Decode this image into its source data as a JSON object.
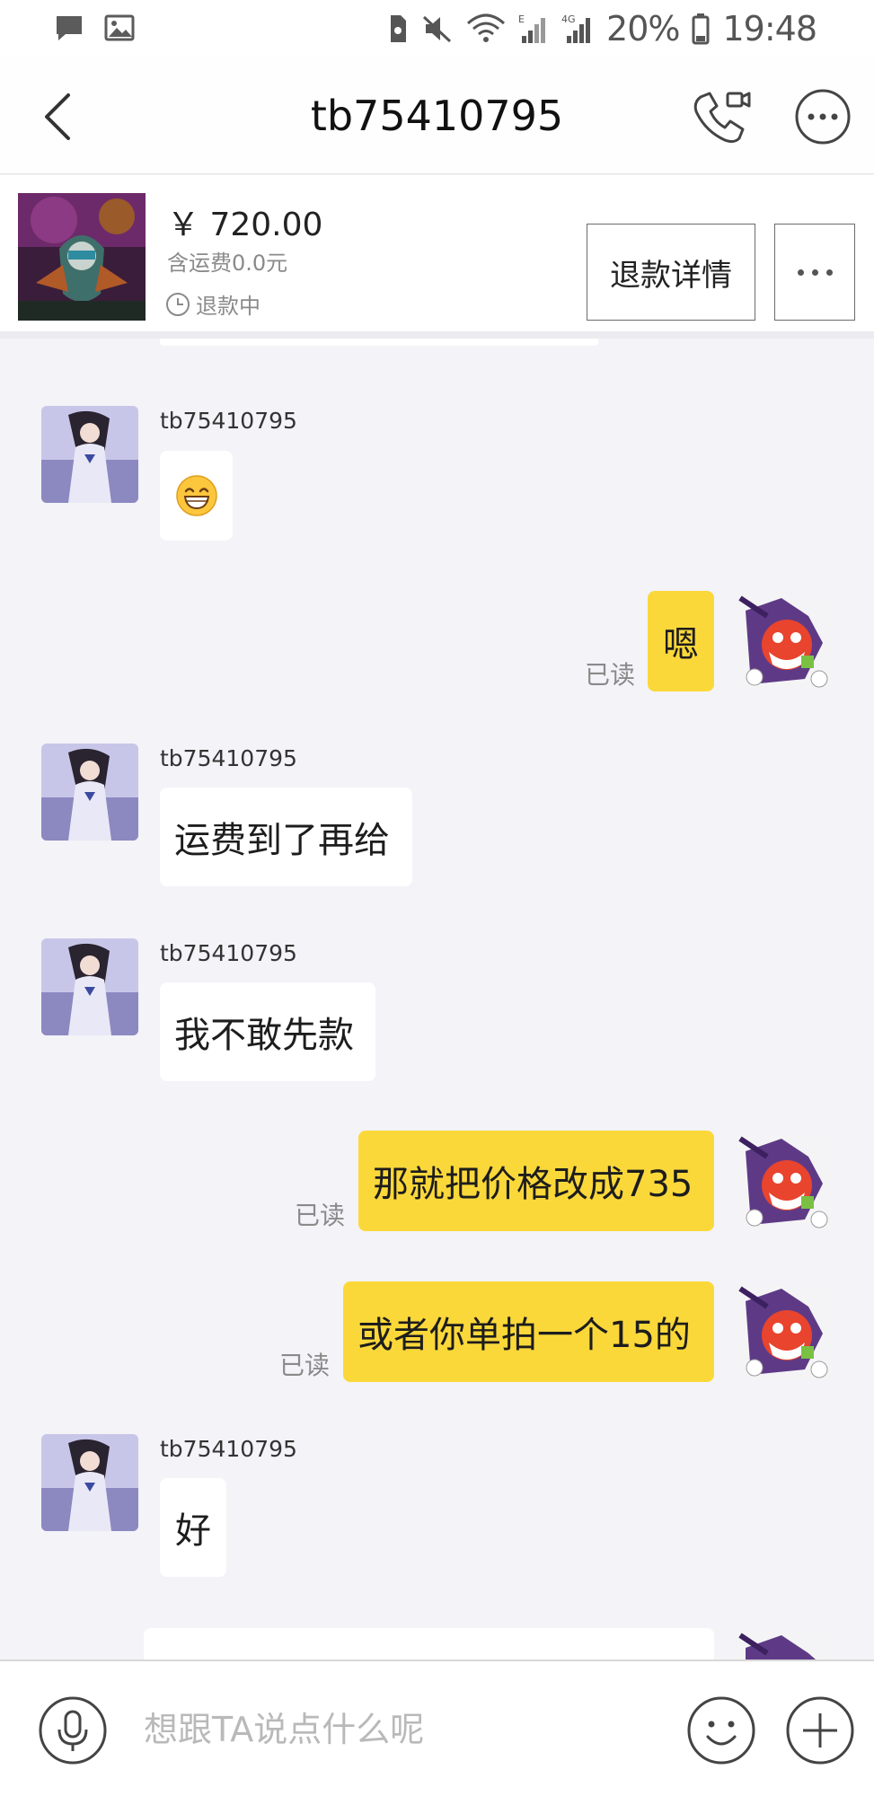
{
  "status_bar": {
    "battery_percent": "20%",
    "time": "19:48",
    "icons": [
      "message-icon",
      "image-icon",
      "sim-icon",
      "mute-icon",
      "wifi-icon",
      "signal-e-icon",
      "signal-4g-icon",
      "battery-icon"
    ]
  },
  "header": {
    "title": "tb75410795",
    "icons": [
      "back-arrow-icon",
      "video-call-icon",
      "more-icon"
    ]
  },
  "order": {
    "price": "￥ 720.00",
    "shipping": "含运费0.0元",
    "status": "退款中",
    "refund_button": "退款详情"
  },
  "messages": [
    {
      "side": "in",
      "sender": "tb75410795",
      "emoji": "grinning-face"
    },
    {
      "side": "out",
      "text": "嗯",
      "read": "已读"
    },
    {
      "side": "in",
      "sender": "tb75410795",
      "text": "运费到了再给"
    },
    {
      "side": "in",
      "sender": "tb75410795",
      "text": "我不敢先款"
    },
    {
      "side": "out",
      "text": "那就把价格改成735",
      "read": "已读"
    },
    {
      "side": "out",
      "text": "或者你单拍一个15的",
      "read": "已读"
    },
    {
      "side": "in",
      "sender": "tb75410795",
      "text": "好"
    }
  ],
  "input": {
    "placeholder": "想跟TA说点什么呢",
    "value": ""
  },
  "colors": {
    "outgoing_bubble": "#fbd83a",
    "incoming_bubble": "#ffffff",
    "chat_background": "#f3f3f8"
  }
}
